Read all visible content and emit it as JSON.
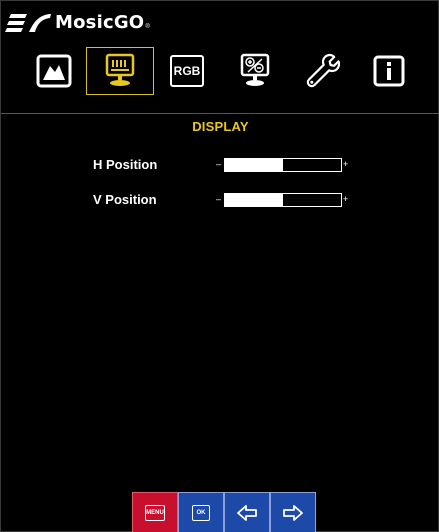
{
  "brand": {
    "name": "MosicGO",
    "reg_mark": "®"
  },
  "tabs": [
    {
      "name": "picture",
      "icon": "picture-mountain-icon"
    },
    {
      "name": "display",
      "icon": "monitor-display-icon",
      "active": true
    },
    {
      "name": "rgb",
      "label": "RGB",
      "icon": "rgb-icon"
    },
    {
      "name": "pip",
      "icon": "monitor-plus-minus-icon"
    },
    {
      "name": "setup",
      "icon": "wrench-icon"
    },
    {
      "name": "info",
      "icon": "info-icon"
    }
  ],
  "section": {
    "title": "DISPLAY"
  },
  "settings": [
    {
      "label": "H Position",
      "minus": "–",
      "plus": "+",
      "level": 0.5
    },
    {
      "label": "V Position",
      "minus": "–",
      "plus": "+",
      "level": 0.5
    }
  ],
  "nav": {
    "menu_label": "MENU",
    "ok_label": "OK"
  },
  "colors": {
    "accent": "#e8c81e",
    "menu_button": "#c8102e",
    "nav_button": "#1d4aa8",
    "background": "#000000"
  }
}
